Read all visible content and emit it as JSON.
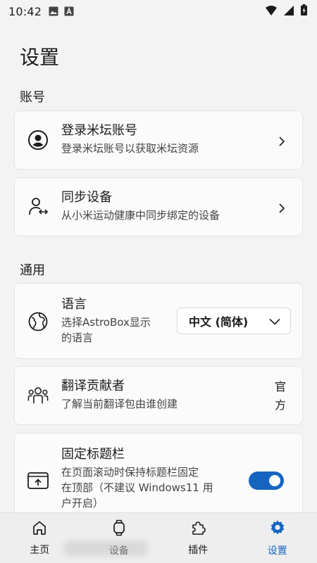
{
  "status_bar": {
    "time": "10:42"
  },
  "page": {
    "title": "设置"
  },
  "sections": {
    "account": "账号",
    "general": "通用"
  },
  "account_items": [
    {
      "title": "登录米坛账号",
      "subtitle": "登录米坛账号以获取米坛资源"
    },
    {
      "title": "同步设备",
      "subtitle": "从小米运动健康中同步绑定的设备"
    }
  ],
  "language": {
    "title": "语言",
    "subtitle_line1": "选择AstroBox显示",
    "subtitle_line2": "的语言",
    "selected": "中文 (简体)"
  },
  "translators": {
    "title": "翻译贡献者",
    "subtitle": "了解当前翻译包由谁创建",
    "value_line1": "官",
    "value_line2": "方"
  },
  "fixed_titlebar": {
    "title": "固定标题栏",
    "desc_line1": "在页面滚动时保持标题栏固定",
    "desc_line2": "在顶部（不建议 Windows11 用",
    "desc_line3": "户开启）",
    "enabled": true
  },
  "bottom_nav": [
    {
      "label": "主页",
      "icon": "home-icon"
    },
    {
      "label": "设备",
      "icon": "watch-icon"
    },
    {
      "label": "插件",
      "icon": "puzzle-icon"
    },
    {
      "label": "设置",
      "icon": "gear-icon",
      "active": true
    }
  ],
  "colors": {
    "accent": "#1565c0",
    "background": "#f3f3f3",
    "card": "#fbfbfb"
  }
}
